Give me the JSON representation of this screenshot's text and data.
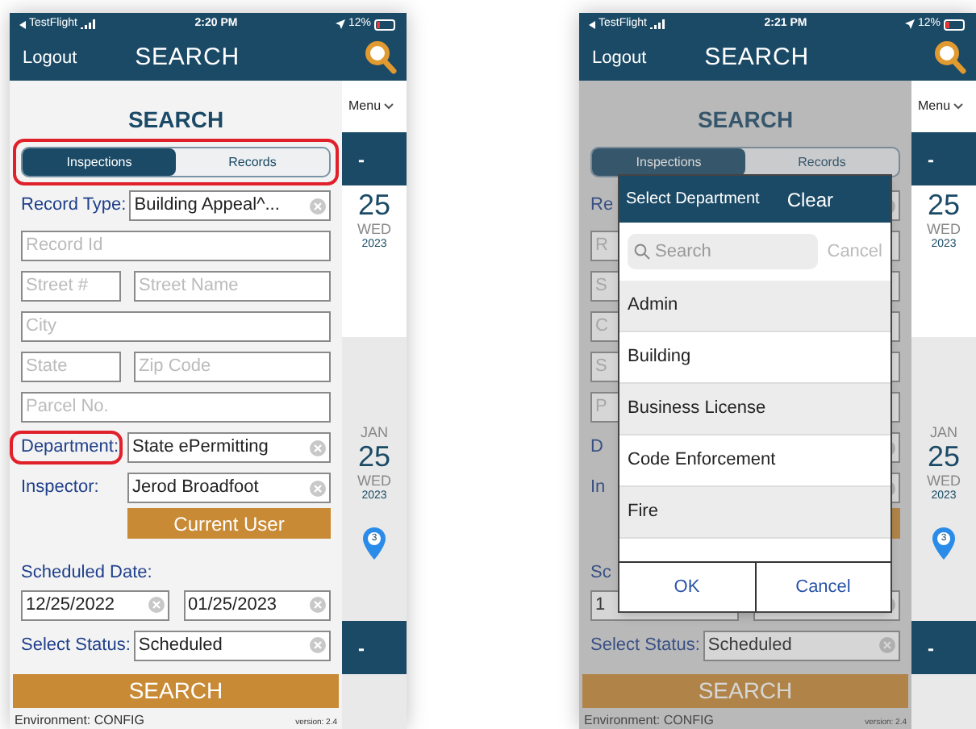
{
  "phones": [
    {
      "status_bar": {
        "carrier": "TestFlight",
        "time": "2:20 PM",
        "battery": "12%"
      },
      "header": {
        "left": "Logout",
        "title": "SEARCH"
      },
      "dimmed": false,
      "heading": "SEARCH",
      "tabs_highlighted": true,
      "tabs": [
        {
          "label": "Inspections",
          "selected": true
        },
        {
          "label": "Records",
          "selected": false
        }
      ],
      "rows": [
        {
          "kind": "labeled",
          "label": "Record Type:",
          "value": "Building Appeal^...",
          "highlighted": false
        },
        {
          "kind": "input",
          "placeholder": "Record Id"
        },
        {
          "kind": "pair",
          "placeholders": [
            "Street #",
            "Street Name"
          ]
        },
        {
          "kind": "input",
          "placeholder": "City"
        },
        {
          "kind": "pair",
          "placeholders": [
            "State",
            "Zip Code"
          ]
        },
        {
          "kind": "input",
          "placeholder": "Parcel No."
        },
        {
          "kind": "labeled",
          "label": "Department:",
          "value": "State ePermitting",
          "highlighted": true
        },
        {
          "kind": "labeled",
          "label": "Inspector:",
          "value": "Jerod Broadfoot",
          "highlighted": false
        },
        {
          "kind": "button",
          "label": "Current User"
        },
        {
          "kind": "caption",
          "label": "Scheduled Date:"
        },
        {
          "kind": "dates",
          "values": [
            "12/25/2022",
            "01/25/2023"
          ]
        },
        {
          "kind": "labeled",
          "label": "Select Status:",
          "value": "Scheduled",
          "highlighted": false
        }
      ],
      "search_button": "SEARCH",
      "environment": "Environment: CONFIG",
      "version": "version: 2.4",
      "side": {
        "menu": "Menu",
        "bar": "-",
        "first_date": {
          "day": "25",
          "weekday": "WED",
          "year": "2023"
        },
        "second_date": {
          "month": "JAN",
          "day": "25",
          "weekday": "WED",
          "year": "2023"
        },
        "pin": "3",
        "bottom_bar": "-"
      }
    },
    {
      "status_bar": {
        "carrier": "TestFlight",
        "time": "2:21 PM",
        "battery": "12%"
      },
      "header": {
        "left": "Logout",
        "title": "SEARCH"
      },
      "dimmed": true,
      "heading": "SEARCH",
      "tabs_highlighted": false,
      "tabs": [
        {
          "label": "Inspections",
          "selected": true
        },
        {
          "label": "Records",
          "selected": false
        }
      ],
      "rows": [
        {
          "kind": "labeled",
          "label": "Re",
          "highlighted": false
        },
        {
          "kind": "input",
          "placeholder": "R"
        },
        {
          "kind": "pair",
          "placeholders": [
            "S"
          ]
        },
        {
          "kind": "input",
          "placeholder": "C"
        },
        {
          "kind": "pair",
          "placeholders": [
            "S"
          ]
        },
        {
          "kind": "input",
          "placeholder": "P"
        },
        {
          "kind": "labeled",
          "label": "D",
          "highlighted": false
        },
        {
          "kind": "labeled",
          "label": "In",
          "highlighted": false
        },
        {
          "kind": "button"
        },
        {
          "kind": "caption",
          "label": "Sc"
        },
        {
          "kind": "dates",
          "values": [
            "1"
          ]
        },
        {
          "kind": "labeled",
          "label": "Select Status:",
          "value": "Scheduled",
          "highlighted": false
        }
      ],
      "search_button": "SEARCH",
      "environment": "Environment: CONFIG",
      "version": "version: 2.4",
      "side": {
        "menu": "Menu",
        "bar": "-",
        "first_date": {
          "day": "25",
          "weekday": "WED",
          "year": "2023"
        },
        "second_date": {
          "month": "JAN",
          "day": "25",
          "weekday": "WED",
          "year": "2023"
        },
        "pin": "3",
        "bottom_bar": "-"
      },
      "dialog": {
        "title": "Select Department",
        "clear": "Clear",
        "search_placeholder": "Search",
        "cancel_search": "Cancel",
        "items": [
          "Admin",
          "Building",
          "Business License",
          "Code Enforcement",
          "Fire"
        ],
        "ok": "OK",
        "cancel": "Cancel"
      }
    }
  ]
}
